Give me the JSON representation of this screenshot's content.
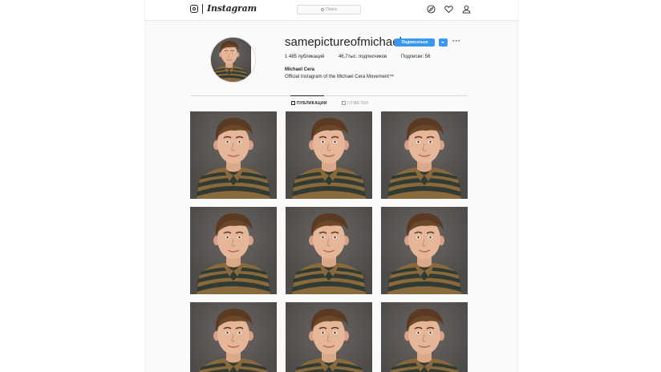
{
  "nav": {
    "brand": "Instagram",
    "search_placeholder": "Поиск",
    "icons": [
      "instagram-glyph-icon",
      "search-icon",
      "compass-icon",
      "heart-icon",
      "user-icon"
    ]
  },
  "profile": {
    "username": "samepictureofmichaelcera",
    "follow_label": "Подписаться",
    "more_label": "···",
    "stats": {
      "posts": "1 485 публикаций",
      "followers": "46,7тыс. подписчиков",
      "following": "Подписки: 56"
    },
    "full_name": "Michael Cera",
    "bio": "Official Instagram of the Michael Cera Movement™"
  },
  "tabs": [
    {
      "label": "ПУБЛИКАЦИИ",
      "active": true
    },
    {
      "label": "ОТМЕТКИ",
      "active": false
    }
  ],
  "grid": {
    "photos": [
      "portrait",
      "portrait",
      "portrait",
      "portrait",
      "portrait",
      "portrait",
      "portrait",
      "portrait",
      "portrait"
    ]
  },
  "colors": {
    "accent": "#3897f0",
    "background": "#fafafa",
    "text": "#262626"
  }
}
